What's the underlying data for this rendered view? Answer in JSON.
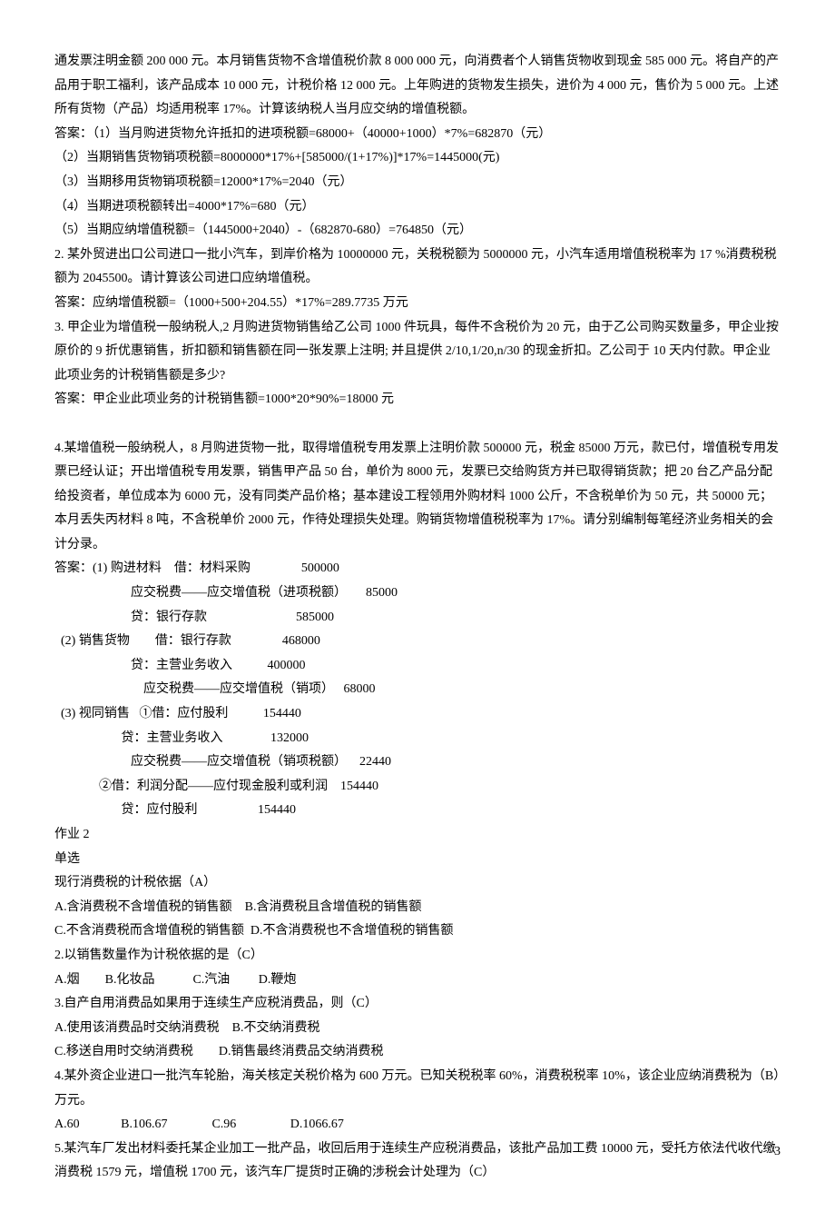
{
  "lines": [
    "通发票注明金额 200 000 元。本月销售货物不含增值税价款 8 000 000 元，向消费者个人销售货物收到现金 585 000 元。将自产的产品用于职工福利，该产品成本 10 000 元，计税价格 12 000 元。上年购进的货物发生损失，进价为 4 000 元，售价为 5 000 元。上述所有货物（产品）均适用税率 17%。计算该纳税人当月应交纳的增值税额。",
    "答案：（1）当月购进货物允许抵扣的进项税额=68000+（40000+1000）*7%=682870（元）",
    "（2）当期销售货物销项税额=8000000*17%+[585000/(1+17%)]*17%=1445000(元)",
    "（3）当期移用货物销项税额=12000*17%=2040（元）",
    "（4）当期进项税额转出=4000*17%=680（元）",
    "（5）当期应纳增值税额=（1445000+2040）-（682870-680）=764850（元）",
    "2. 某外贸进出口公司进口一批小汽车，到岸价格为 10000000 元，关税税额为 5000000 元，小汽车适用增值税税率为 17 %消费税税额为 2045500。请计算该公司进口应纳增值税。",
    "答案：应纳增值税额=（1000+500+204.55）*17%=289.7735 万元",
    "3. 甲企业为增值税一般纳税人,2 月购进货物销售给乙公司 1000 件玩具，每件不含税价为 20 元，由于乙公司购买数量多，甲企业按原价的 9 折优惠销售，折扣额和销售额在同一张发票上注明; 并且提供 2/10,1/20,n/30 的现金折扣。乙公司于 10 天内付款。甲企业此项业务的计税销售额是多少?",
    "答案：甲企业此项业务的计税销售额=1000*20*90%=18000 元",
    "",
    "4.某增值税一般纳税人，8 月购进货物一批，取得增值税专用发票上注明价款 500000 元，税金 85000 万元，款已付，增值税专用发票已经认证；开出增值税专用发票，销售甲产品 50 台，单价为 8000 元，发票已交给购货方并已取得销货款；把 20 台乙产品分配给投资者，单位成本为 6000 元，没有同类产品价格；基本建设工程领用外购材料 1000 公斤，不含税单价为 50 元，共 50000 元；本月丢失丙材料 8 吨，不含税单价 2000 元，作待处理损失处理。购销货物增值税税率为 17%。请分别编制每笔经济业务相关的会计分录。",
    "答案：(1) 购进材料    借：材料采购                500000",
    "                        应交税费——应交增值税（进项税额）      85000",
    "                        贷：银行存款                            585000",
    "  (2) 销售货物        借：银行存款                468000",
    "                        贷：主营业务收入           400000",
    "                            应交税费——应交增值税（销项）   68000",
    "  (3) 视同销售   ①借：应付股利           154440",
    "                     贷：主营业务收入               132000",
    "                        应交税费——应交增值税（销项税额）    22440",
    "              ②借：利润分配——应付现金股利或利润    154440",
    "                     贷：应付股利                   154440",
    "作业 2",
    "单选",
    "现行消费税的计税依据（A）",
    "A.含消费税不含增值税的销售额    B.含消费税且含增值税的销售额",
    "C.不含消费税而含增值税的销售额  D.不含消费税也不含增值税的销售额",
    "2.以销售数量作为计税依据的是（C）",
    "A.烟        B.化妆品            C.汽油         D.鞭炮",
    "3.自产自用消费品如果用于连续生产应税消费品，则（C）",
    "A.使用该消费品时交纳消费税    B.不交纳消费税",
    "C.移送自用时交纳消费税        D.销售最终消费品交纳消费税",
    "4.某外资企业进口一批汽车轮胎，海关核定关税价格为 600 万元。已知关税税率 60%，消费税税率 10%，该企业应纳消费税为（B）万元。",
    "A.60             B.106.67              C.96                 D.1066.67",
    "5.某汽车厂发出材料委托某企业加工一批产品，收回后用于连续生产应税消费品，该批产品加工费 10000 元，受托方依法代收代缴消费税 1579 元，增值税 1700 元，该汽车厂提货时正确的涉税会计处理为（C）"
  ],
  "pageNumber": "3"
}
